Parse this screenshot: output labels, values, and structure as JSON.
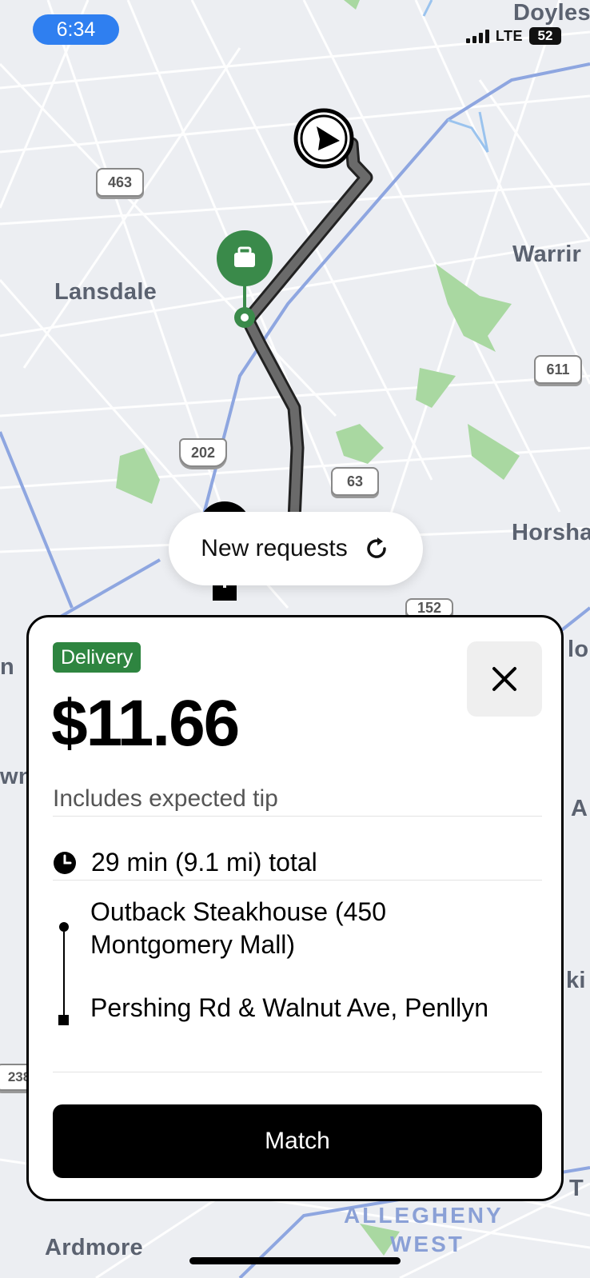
{
  "status_bar": {
    "time": "6:34",
    "network": "LTE",
    "battery": "52"
  },
  "map": {
    "labels": {
      "doylestown": "Doyles",
      "warrington": "Warrir",
      "lansdale": "Lansdale",
      "horsham": "Horsha",
      "ardmore": "Ardmore",
      "allegheny": "ALLEGHENY",
      "west": "WEST",
      "edge_n": "n",
      "edge_wn": "wn",
      "edge_lo": "lo",
      "edge_a": "A",
      "edge_ki": "ki",
      "edge_t": "T"
    },
    "shields": {
      "r463": "463",
      "r611": "611",
      "r202": "202",
      "r63": "63",
      "r152": "152",
      "r238": "238"
    }
  },
  "new_requests": {
    "label": "New requests"
  },
  "offer": {
    "badge": "Delivery",
    "price": "$11.66",
    "subtitle": "Includes expected tip",
    "total": "29 min (9.1 mi) total",
    "pickup": "Outback Steakhouse (450 Montgomery Mall)",
    "dropoff": "Pershing Rd & Walnut Ave, Penllyn",
    "match_button": "Match"
  },
  "colors": {
    "accent_blue": "#2f7ff0",
    "badge_green": "#2e8540",
    "park_green": "#a9d8a1",
    "route_gray": "#6a6a6a"
  }
}
